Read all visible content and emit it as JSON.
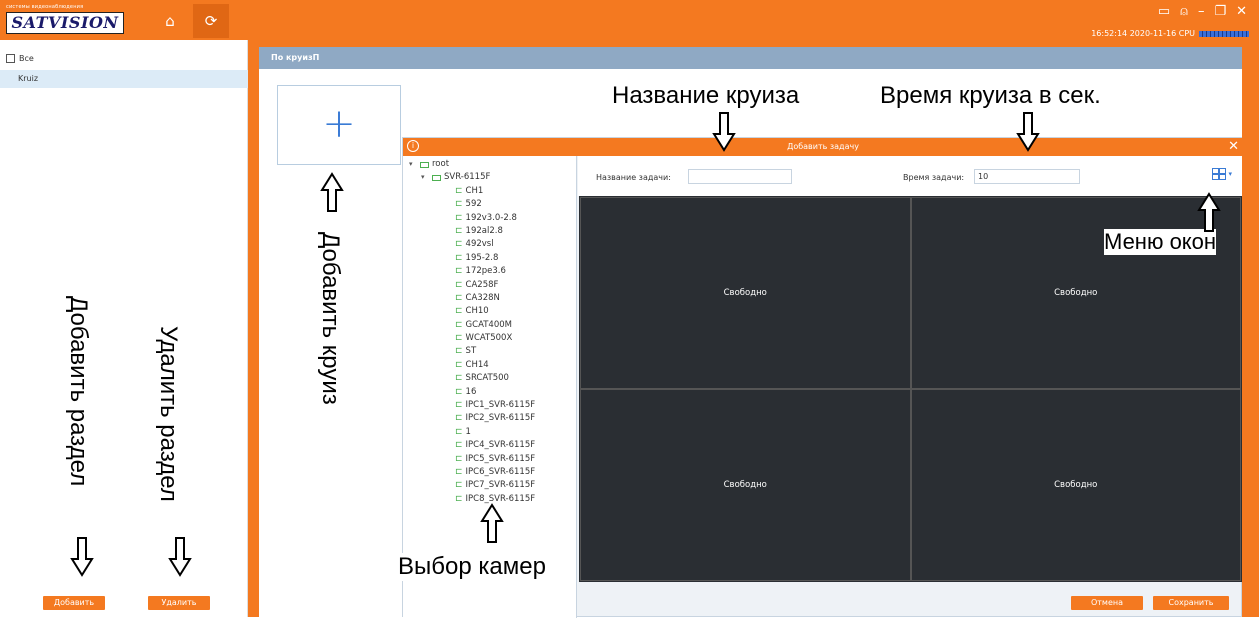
{
  "titlebar": {
    "logo_small_text": "системы видеонаблюдения",
    "logo_brand": "SATVISION",
    "clock": "16:52:14 2020-11-16 CPU",
    "icons": [
      "home-icon",
      "cruise-icon",
      "monitor-icon",
      "user-icon",
      "minimize-icon",
      "restore-icon",
      "close-icon"
    ]
  },
  "sidebar": {
    "all_label": "Все",
    "items": [
      {
        "label": "Kruiz"
      }
    ],
    "add_label": "Добавить",
    "delete_label": "Удалить"
  },
  "panel": {
    "header": "По круизП"
  },
  "dialog": {
    "title": "Добавить задачу",
    "task_name_label": "Название задачи:",
    "task_name_value": "",
    "task_time_label": "Время задачи:",
    "task_time_value": "10",
    "cancel_label": "Отмена",
    "save_label": "Сохранить",
    "tree": {
      "root": "root",
      "device": "SVR-6115F",
      "cameras": [
        "CH1",
        "592",
        "192v3.0-2.8",
        "192al2.8",
        "492vsl",
        "195-2.8",
        "172pe3.6",
        "CA258F",
        "CA328N",
        "CH10",
        "GCAT400M",
        "WCAT500X",
        "ST",
        "CH14",
        "SRCAT500",
        "16",
        "IPC1_SVR-6115F",
        "IPC2_SVR-6115F",
        "1",
        "IPC4_SVR-6115F",
        "IPC5_SVR-6115F",
        "IPC6_SVR-6115F",
        "IPC7_SVR-6115F",
        "IPC8_SVR-6115F"
      ]
    },
    "cells": [
      "Свободно",
      "Свободно",
      "Свободно",
      "Свободно"
    ]
  },
  "annotations": {
    "cruise_name": "Название круиза",
    "cruise_time": "Время круиза в сек.",
    "window_menu": "Меню окон",
    "camera_select": "Выбор камер",
    "add_cruise": "Добавить круиз",
    "add_section": "Добавить раздел",
    "delete_section": "Удалить раздел"
  },
  "colors": {
    "accent_orange": "#f47920",
    "panel_header": "#8fa9c4",
    "video_bg": "#2a2e33",
    "selection": "#dcebf7",
    "camera_icon": "#4caf50",
    "link_blue": "#3a7bd5"
  }
}
